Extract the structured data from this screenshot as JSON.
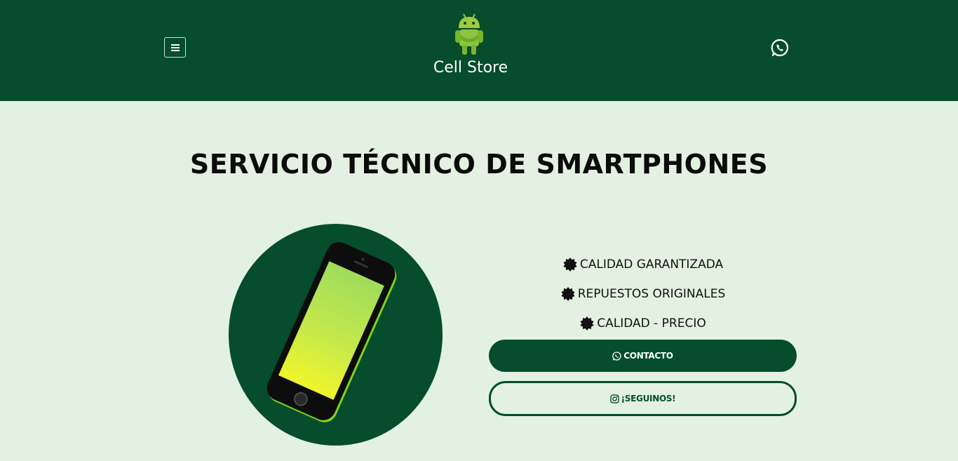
{
  "header": {
    "brand": "Cell Store",
    "menu_icon": "hamburger-icon",
    "logo_icon": "android-robot-logo",
    "whatsapp_icon": "whatsapp-icon",
    "background": "#054d2c"
  },
  "main": {
    "title": "SERVICIO TÉCNICO DE SMARTPHONES",
    "features": [
      {
        "label": "CALIDAD GARANTIZADA",
        "icon": "badge-icon"
      },
      {
        "label": "REPUESTOS ORIGINALES",
        "icon": "badge-icon"
      },
      {
        "label": "CALIDAD - PRECIO",
        "icon": "badge-icon"
      }
    ],
    "contact_button": {
      "label": "CONTACTO",
      "icon": "whatsapp-icon"
    },
    "follow_button": {
      "label": "¡SEGUINOS!",
      "icon": "instagram-icon"
    },
    "hero_image": "smartphone-illustration"
  },
  "colors": {
    "primary": "#054d2c",
    "page_bg": "#e3f2e0",
    "phone_green": "#7ed321"
  }
}
